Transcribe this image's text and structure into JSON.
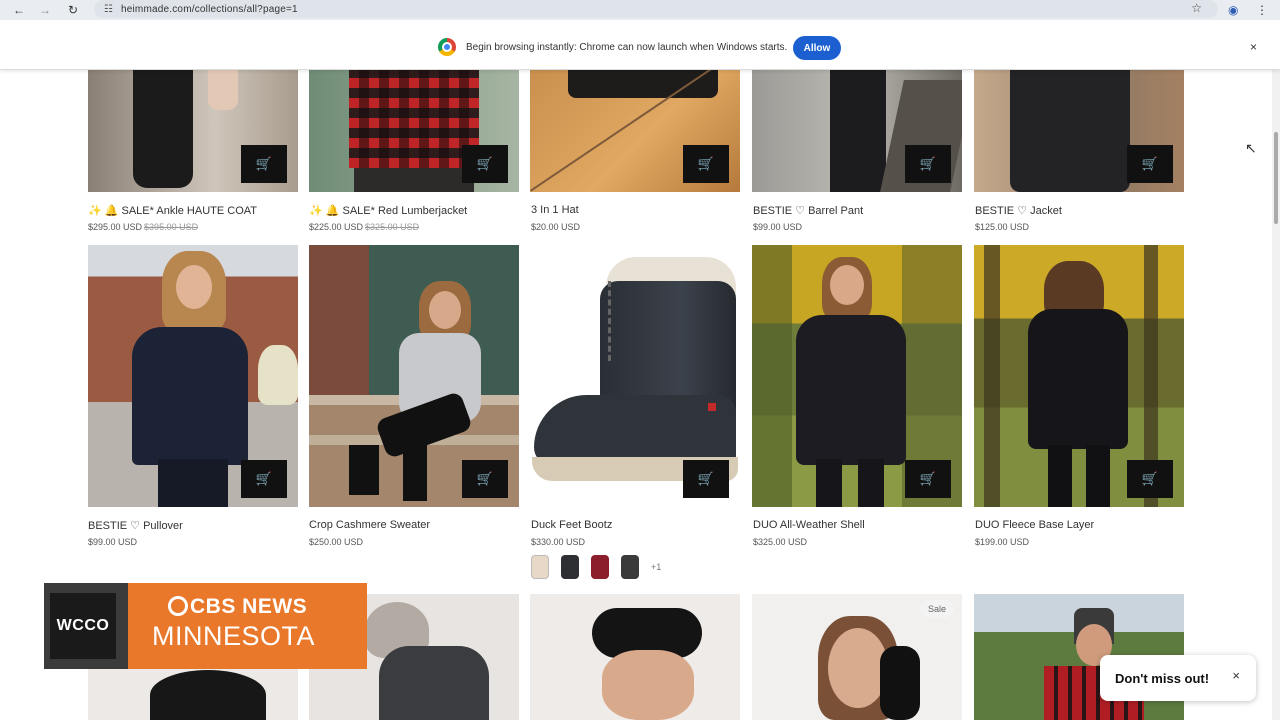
{
  "browser": {
    "url": "heimmade.com/collections/all?page=1",
    "icons": [
      "back-icon",
      "forward-icon",
      "reload-icon",
      "tune-icon",
      "star-icon",
      "profile-icon",
      "menu-icon"
    ]
  },
  "infobar": {
    "text": "Begin browsing instantly: Chrome can now launch when Windows starts.",
    "allow": "Allow",
    "close": "×"
  },
  "products_row1": [
    {
      "title": "✨ 🔔 SALE* Ankle HAUTE COAT",
      "price": "$295.00 USD",
      "compare": "$395.00 USD"
    },
    {
      "title": "✨ 🔔 SALE* Red Lumberjacket",
      "price": "$225.00 USD",
      "compare": "$325.00 USD"
    },
    {
      "title": "3 In 1 Hat",
      "price": "$20.00 USD",
      "compare": ""
    },
    {
      "title": "BESTIE ♡ Barrel Pant",
      "price": "$99.00 USD",
      "compare": ""
    },
    {
      "title": "BESTIE ♡ Jacket",
      "price": "$125.00 USD",
      "compare": ""
    }
  ],
  "products_row2": [
    {
      "title": "BESTIE ♡ Pullover",
      "price": "$99.00 USD"
    },
    {
      "title": "Crop Cashmere Sweater",
      "price": "$250.00 USD"
    },
    {
      "title": "Duck Feet Bootz",
      "price": "$330.00 USD"
    },
    {
      "title": "DUO All-Weather Shell",
      "price": "$325.00 USD"
    },
    {
      "title": "DUO Fleece Base Layer",
      "price": "$199.00 USD"
    }
  ],
  "swatches": {
    "colors": [
      "#e8d8c8",
      "#2d2f33",
      "#8b1e2a",
      "#3a3a3a"
    ],
    "more": "+1"
  },
  "row3": {
    "sale_badge": "Sale"
  },
  "broadcast": {
    "station": "WCCO",
    "network": "CBS NEWS",
    "region": "MINNESOTA"
  },
  "toast": {
    "text": "Don't miss out!",
    "close": "×"
  }
}
